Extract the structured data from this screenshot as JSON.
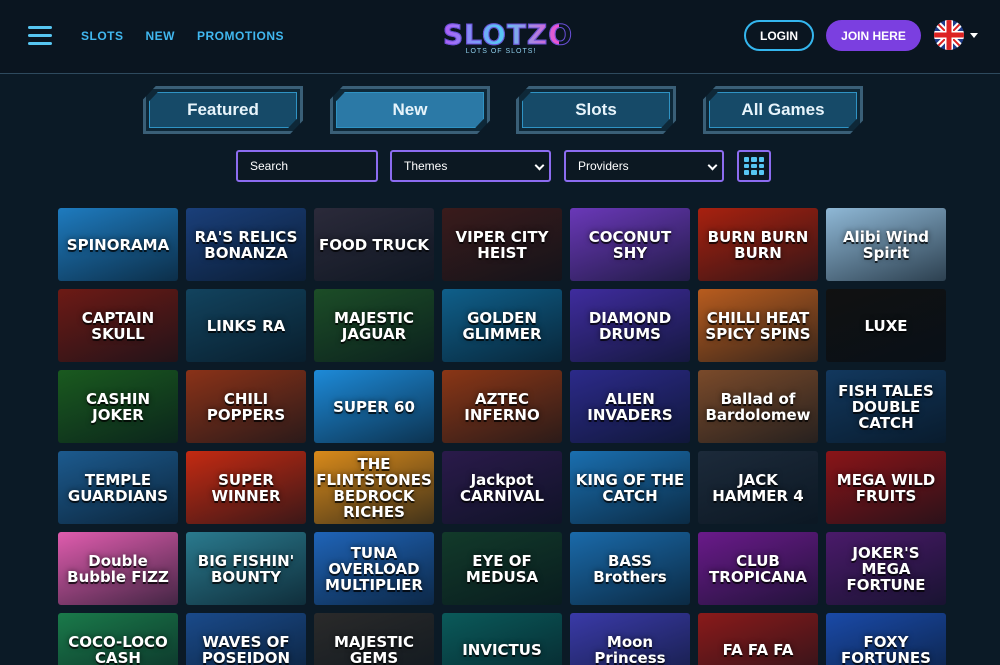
{
  "header": {
    "nav": [
      "SLOTS",
      "NEW",
      "PROMOTIONS"
    ],
    "logo_main": "SLOTZO",
    "logo_sub": "LOTS OF SLOTS!",
    "login_label": "LOGIN",
    "join_label": "JOIN HERE",
    "language_icon": "uk-flag-icon"
  },
  "tabs": [
    {
      "label": "Featured",
      "active": false
    },
    {
      "label": "New",
      "active": true
    },
    {
      "label": "Slots",
      "active": false
    },
    {
      "label": "All Games",
      "active": false
    }
  ],
  "filters": {
    "search_placeholder": "Search",
    "themes_value": "Themes",
    "providers_value": "Providers"
  },
  "games": [
    {
      "title": "SPINORAMA",
      "color": "#1e7bbf"
    },
    {
      "title": "RA'S RELICS BONANZA",
      "color": "#1a3f7a"
    },
    {
      "title": "FOOD TRUCK",
      "color": "#2b2a3a"
    },
    {
      "title": "VIPER CITY HEIST",
      "color": "#3a1b1b"
    },
    {
      "title": "COCONUT SHY",
      "color": "#6a38b8"
    },
    {
      "title": "BURN BURN BURN",
      "color": "#a8210f"
    },
    {
      "title": "Alibi Wind Spirit",
      "color": "#8fb8d6"
    },
    {
      "title": "CAPTAIN SKULL",
      "color": "#6d1a15"
    },
    {
      "title": "LINKS RA",
      "color": "#12435e"
    },
    {
      "title": "MAJESTIC JAGUAR",
      "color": "#1c4d27"
    },
    {
      "title": "GOLDEN GLIMMER",
      "color": "#0f5f8a"
    },
    {
      "title": "DIAMOND DRUMS",
      "color": "#3f2c9e"
    },
    {
      "title": "CHILLI HEAT SPICY SPINS",
      "color": "#b85c1e"
    },
    {
      "title": "LUXE",
      "color": "#111111"
    },
    {
      "title": "CASHIN JOKER",
      "color": "#1a5a1f"
    },
    {
      "title": "CHILI POPPERS",
      "color": "#8a3218"
    },
    {
      "title": "SUPER 60",
      "color": "#1d8ad8"
    },
    {
      "title": "AZTEC INFERNO",
      "color": "#8a3616"
    },
    {
      "title": "ALIEN INVADERS",
      "color": "#2c2a8a"
    },
    {
      "title": "Ballad of Bardolomew",
      "color": "#7a4a2a"
    },
    {
      "title": "FISH TALES DOUBLE CATCH",
      "color": "#12385e"
    },
    {
      "title": "TEMPLE GUARDIANS",
      "color": "#1c5a8e"
    },
    {
      "title": "SUPER WINNER",
      "color": "#c42a12"
    },
    {
      "title": "THE FLINTSTONES BEDROCK RICHES",
      "color": "#d98a1a"
    },
    {
      "title": "Jackpot CARNIVAL",
      "color": "#2a1a4a"
    },
    {
      "title": "KING OF THE CATCH",
      "color": "#1a6fb0"
    },
    {
      "title": "JACK HAMMER 4",
      "color": "#1c2a3a"
    },
    {
      "title": "MEGA WILD FRUITS",
      "color": "#8a1418"
    },
    {
      "title": "Double Bubble FIZZ",
      "color": "#e05cae"
    },
    {
      "title": "BIG FISHIN' BOUNTY",
      "color": "#2a7a8e"
    },
    {
      "title": "TUNA OVERLOAD MULTIPLIER",
      "color": "#1f64b8"
    },
    {
      "title": "EYE OF MEDUSA",
      "color": "#123a2a"
    },
    {
      "title": "BASS Brothers",
      "color": "#1a6aaa"
    },
    {
      "title": "CLUB TROPICANA",
      "color": "#6a1a8a"
    },
    {
      "title": "JOKER'S MEGA FORTUNE",
      "color": "#4a1a6a"
    },
    {
      "title": "COCO-LOCO CASH",
      "color": "#1a7a4a"
    },
    {
      "title": "WAVES OF POSEIDON",
      "color": "#1a4a8a"
    },
    {
      "title": "MAJESTIC GEMS",
      "color": "#2a2a2a"
    },
    {
      "title": "INVICTUS",
      "color": "#0a5a5a"
    },
    {
      "title": "Moon Princess",
      "color": "#3a3aa8"
    },
    {
      "title": "FA FA FA",
      "color": "#8a1a1a"
    },
    {
      "title": "FOXY FORTUNES",
      "color": "#1a4aa8"
    }
  ]
}
